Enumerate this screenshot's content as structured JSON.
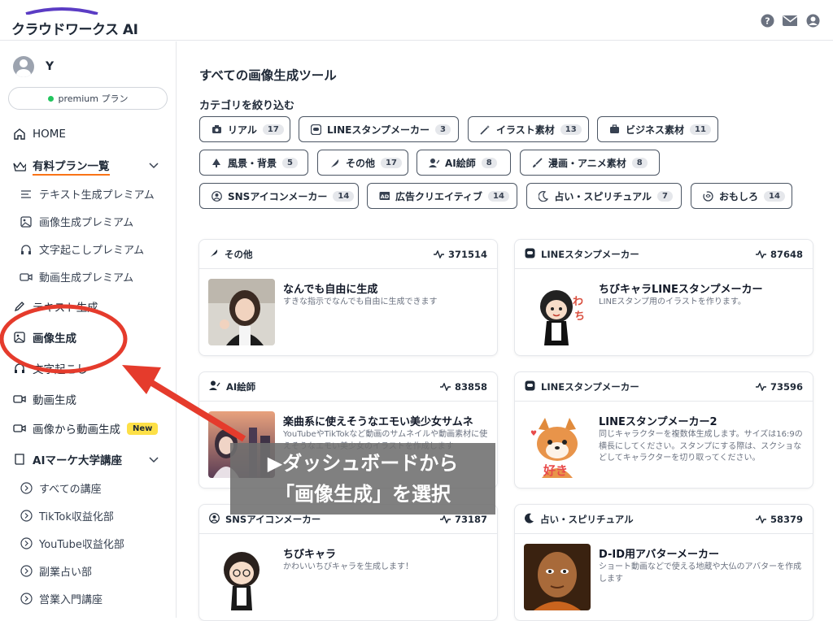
{
  "header": {
    "logo_text": "クラウドワークス AI",
    "icons": [
      "help-icon",
      "mail-icon",
      "account-icon"
    ]
  },
  "sidebar": {
    "user_name": "Y",
    "plan_label": "premium プラン",
    "items": [
      {
        "label": "HOME",
        "icon": "home-icon"
      },
      {
        "label": "有料プラン一覧",
        "icon": "crown-icon"
      },
      {
        "label": "テキスト生成プレミアム",
        "icon": "text-lines-icon"
      },
      {
        "label": "画像生成プレミアム",
        "icon": "image-icon"
      },
      {
        "label": "文字起こしプレミアム",
        "icon": "headphones-icon"
      },
      {
        "label": "動画生成プレミアム",
        "icon": "video-icon"
      },
      {
        "label": "テキスト生成",
        "icon": "pencil-icon"
      },
      {
        "label": "画像生成",
        "icon": "image-icon"
      },
      {
        "label": "文字起こし",
        "icon": "headphones-icon"
      },
      {
        "label": "動画生成",
        "icon": "video-icon"
      },
      {
        "label": "画像から動画生成",
        "icon": "video-icon",
        "badge": "New"
      },
      {
        "label": "AIマーケ大学講座",
        "icon": "book-icon"
      },
      {
        "label": "すべての講座",
        "icon": "chevron-circle-icon"
      },
      {
        "label": "TikTok収益化部",
        "icon": "chevron-circle-icon"
      },
      {
        "label": "YouTube収益化部",
        "icon": "chevron-circle-icon"
      },
      {
        "label": "副業占い部",
        "icon": "chevron-circle-icon"
      },
      {
        "label": "営業入門講座",
        "icon": "chevron-circle-icon"
      }
    ]
  },
  "main": {
    "title": "すべての画像生成ツール",
    "filter_title": "カテゴリを絞り込む",
    "chips": [
      {
        "label": "リアル",
        "count": "17",
        "icon": "camera-icon"
      },
      {
        "label": "LINEスタンプメーカー",
        "count": "3",
        "icon": "line-icon"
      },
      {
        "label": "イラスト素材",
        "count": "13",
        "icon": "magic-wand-icon"
      },
      {
        "label": "ビジネス素材",
        "count": "11",
        "icon": "briefcase-icon"
      },
      {
        "label": "風景・背景",
        "count": "5",
        "icon": "tree-icon"
      },
      {
        "label": "その他",
        "count": "17",
        "icon": "feather-icon"
      },
      {
        "label": "AI絵師",
        "count": "8",
        "icon": "artist-icon"
      },
      {
        "label": "漫画・アニメ素材",
        "count": "8",
        "icon": "brush-icon"
      },
      {
        "label": "SNSアイコンメーカー",
        "count": "14",
        "icon": "user-circle-icon"
      },
      {
        "label": "広告クリエイティブ",
        "count": "14",
        "icon": "ad-icon"
      },
      {
        "label": "占い・スピリチュアル",
        "count": "7",
        "icon": "moon-icon"
      },
      {
        "label": "おもしろ",
        "count": "14",
        "icon": "swirl-icon"
      }
    ],
    "cards": [
      {
        "category": "その他",
        "count": "371514",
        "title": "なんでも自由に生成",
        "desc": "すきな指示でなんでも自由に生成できます",
        "icon": "feather-icon"
      },
      {
        "category": "LINEスタンプメーカー",
        "count": "87648",
        "title": "ちびキャラLINEスタンプメーカー",
        "desc": "LINEスタンプ用のイラストを作ります。",
        "icon": "line-icon"
      },
      {
        "category": "AI絵師",
        "count": "83858",
        "title": "楽曲系に使えそうなエモい美少女サムネ",
        "desc": "YouTubeやTikTokなど動画のサムネイルや動画素材に使えそうなエモい美少女のイラストを作成します",
        "icon": "artist-icon"
      },
      {
        "category": "LINEスタンプメーカー",
        "count": "73596",
        "title": "LINEスタンプメーカー2",
        "desc": "同じキャラクターを複数体生成します。サイズは16:9の横長にしてください。スタンプにする際は、スクショなどしてキャラクターを切り取ってください。",
        "icon": "line-icon"
      },
      {
        "category": "SNSアイコンメーカー",
        "count": "73187",
        "title": "ちびキャラ",
        "desc": "かわいいちびキャラを生成します！",
        "icon": "user-circle-icon"
      },
      {
        "category": "占い・スピリチュアル",
        "count": "58379",
        "title": "D-ID用アバターメーカー",
        "desc": "ショート動画などで使える地蔵や大仏のアバターを作成します",
        "icon": "moon-icon"
      }
    ]
  },
  "annotation": {
    "callout_line1": "▶ダッシュボードから",
    "callout_line2": "「画像生成」を選択",
    "color": "#e53b2c"
  }
}
